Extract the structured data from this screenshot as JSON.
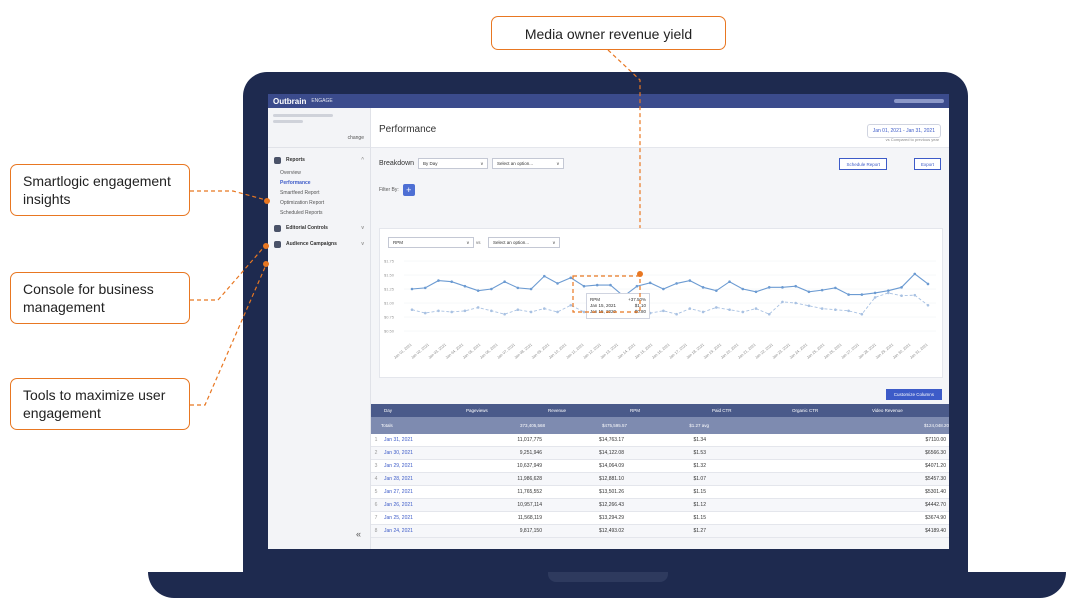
{
  "callouts": {
    "top": "Media owner revenue yield",
    "smartlogic": "Smartlogic engagement insights",
    "console": "Console for business management",
    "tools": "Tools to maximize user engagement"
  },
  "app": {
    "logo": "Outbrain",
    "product": "ENGAGE",
    "page_title": "Performance",
    "date_range": "Jan 01, 2021 - Jan 31, 2021",
    "compare": "vs Compared to previous year",
    "breakdown_label": "Breakdown",
    "breakdown_value": "By Day",
    "select_placeholder": "Select an option...",
    "schedule_btn": "Schedule Report",
    "export_btn": "Export",
    "filter_label": "Filter By:",
    "metric": "RPM",
    "vs": "vs",
    "customize_btn": "Customize Columns",
    "collapse": "«"
  },
  "sidebar": {
    "change": "change",
    "reports": "Reports",
    "items": [
      "Overview",
      "Performance",
      "Smartfeed Report",
      "Optimization Report",
      "Scheduled Reports"
    ],
    "editorial": "Editorial Controls",
    "audience": "Audience Campaigns"
  },
  "tooltip": {
    "title": "RPM",
    "change": "+37.50%",
    "row1_date": "Jan 15, 2021",
    "row1_val": "$1.10",
    "row2_date": "Jan 15, 2020",
    "row2_val": "$0.80"
  },
  "table": {
    "headers": [
      "Day",
      "Pageviews",
      "Revenue",
      "RPM",
      "Paid CTR",
      "Organic CTR",
      "Video Revenue"
    ],
    "totals": {
      "label": "Totals",
      "pageviews": "373,405,568",
      "revenue": "$475,595.57",
      "rpm": "$1.27 avg",
      "video": "$124,048.20"
    },
    "rows": [
      {
        "n": "1",
        "day": "Jan 31, 2021",
        "pv": "11,017,775",
        "rev": "$14,763.17",
        "rpm": "$1.34",
        "vid": "$7110.00"
      },
      {
        "n": "2",
        "day": "Jan 30, 2021",
        "pv": "9,251,946",
        "rev": "$14,122.08",
        "rpm": "$1.53",
        "vid": "$6566.30"
      },
      {
        "n": "3",
        "day": "Jan 29, 2021",
        "pv": "10,637,949",
        "rev": "$14,064.09",
        "rpm": "$1.32",
        "vid": "$4071.20"
      },
      {
        "n": "4",
        "day": "Jan 28, 2021",
        "pv": "11,986,628",
        "rev": "$12,881.10",
        "rpm": "$1.07",
        "vid": "$5457.30"
      },
      {
        "n": "5",
        "day": "Jan 27, 2021",
        "pv": "11,765,552",
        "rev": "$13,501.26",
        "rpm": "$1.15",
        "vid": "$5301.40"
      },
      {
        "n": "6",
        "day": "Jan 26, 2021",
        "pv": "10,957,114",
        "rev": "$12,266.43",
        "rpm": "$1.12",
        "vid": "$4442.70"
      },
      {
        "n": "7",
        "day": "Jan 25, 2021",
        "pv": "11,568,119",
        "rev": "$13,294.29",
        "rpm": "$1.15",
        "vid": "$3674.90"
      },
      {
        "n": "8",
        "day": "Jan 24, 2021",
        "pv": "9,817,150",
        "rev": "$12,493.02",
        "rpm": "$1.27",
        "vid": "$4189.40"
      }
    ]
  },
  "chart_data": {
    "type": "line",
    "xlabel": "",
    "ylabel": "",
    "ylim": [
      0.5,
      1.75
    ],
    "yticks": [
      "$1.75",
      "$1.50",
      "$1.25",
      "$1.00",
      "$0.75",
      "$0.50"
    ],
    "categories": [
      "Jan 01, 2021",
      "Jan 02, 2021",
      "Jan 03, 2021",
      "Jan 04, 2021",
      "Jan 05, 2021",
      "Jan 06, 2021",
      "Jan 07, 2021",
      "Jan 08, 2021",
      "Jan 09, 2021",
      "Jan 10, 2021",
      "Jan 11, 2021",
      "Jan 12, 2021",
      "Jan 13, 2021",
      "Jan 14, 2021",
      "Jan 15, 2021",
      "Jan 16, 2021",
      "Jan 17, 2021",
      "Jan 18, 2021",
      "Jan 19, 2021",
      "Jan 20, 2021",
      "Jan 21, 2021",
      "Jan 22, 2021",
      "Jan 23, 2021",
      "Jan 24, 2021",
      "Jan 25, 2021",
      "Jan 26, 2021",
      "Jan 27, 2021",
      "Jan 28, 2021",
      "Jan 29, 2021",
      "Jan 30, 2021",
      "Jan 31, 2021"
    ],
    "series": [
      {
        "values": [
          1.25,
          1.27,
          1.4,
          1.38,
          1.3,
          1.22,
          1.25,
          1.38,
          1.27,
          1.25,
          1.48,
          1.35,
          1.45,
          1.3,
          1.32,
          1.32,
          1.12,
          1.3,
          1.36,
          1.25,
          1.35,
          1.4,
          1.28,
          1.22,
          1.38,
          1.25,
          1.2,
          1.28,
          1.28,
          1.3,
          1.2,
          1.23,
          1.27,
          1.15,
          1.15,
          1.18,
          1.22,
          1.28,
          1.52,
          1.34
        ]
      },
      {
        "values": [
          0.88,
          0.82,
          0.86,
          0.84,
          0.86,
          0.92,
          0.86,
          0.8,
          0.88,
          0.84,
          0.9,
          0.84,
          0.96,
          0.84,
          0.8,
          0.78,
          0.8,
          0.8,
          0.82,
          0.86,
          0.8,
          0.9,
          0.84,
          0.92,
          0.88,
          0.84,
          0.9,
          0.8,
          1.02,
          1.0,
          0.95,
          0.9,
          0.88,
          0.86,
          0.8,
          1.1,
          1.18,
          1.13,
          1.14,
          0.96
        ]
      }
    ]
  },
  "colors": {
    "accent": "#e87722",
    "navy": "#1e2a4f",
    "brand": "#3d5bc8",
    "line1": "#6c9bd2",
    "line2": "#a8c1e2"
  }
}
